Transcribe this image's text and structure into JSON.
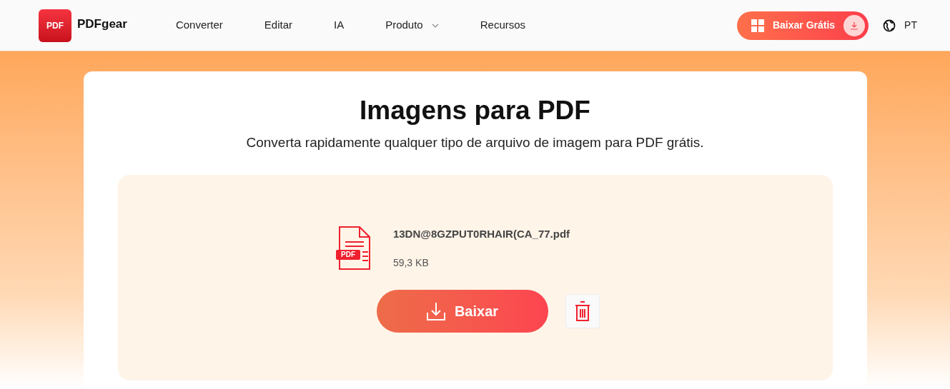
{
  "header": {
    "logo_mark": "PDF",
    "brand": "PDFgear",
    "nav": [
      {
        "label": "Converter",
        "dropdown": false
      },
      {
        "label": "Editar",
        "dropdown": false
      },
      {
        "label": "IA",
        "dropdown": false
      },
      {
        "label": "Produto",
        "dropdown": true
      },
      {
        "label": "Recursos",
        "dropdown": false
      }
    ],
    "download_button": "Baixar Grátis",
    "language": "PT"
  },
  "main": {
    "title": "Imagens para PDF",
    "subtitle": "Converta rapidamente qualquer tipo de arquivo de imagem para PDF grátis.",
    "file": {
      "badge": "PDF",
      "name": "13DN@8GZPUT0RHAIR(CA_77.pdf",
      "size": "59,3 KB"
    },
    "download_button": "Baixar"
  }
}
